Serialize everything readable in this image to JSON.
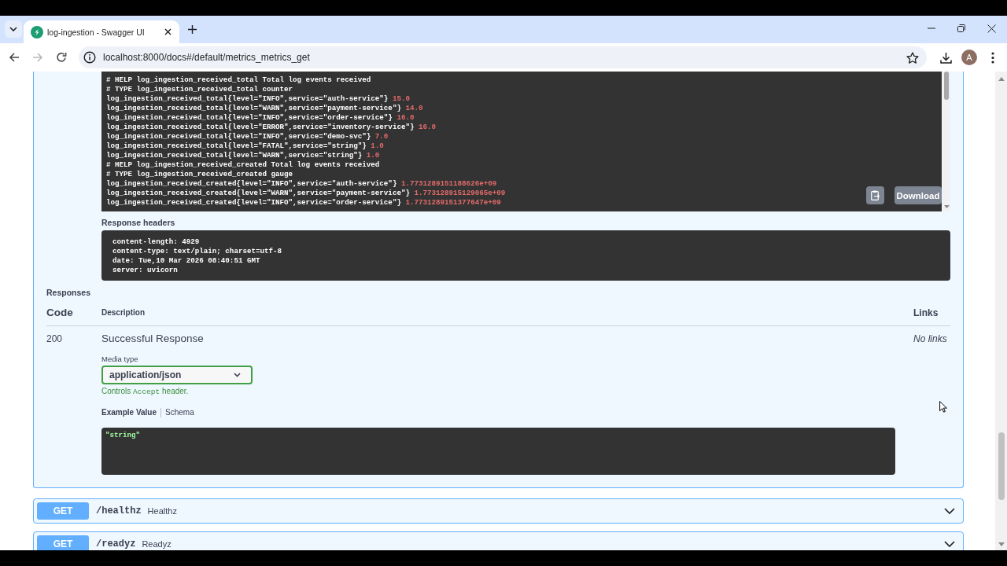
{
  "browser": {
    "tabs": [
      {
        "title": "log-ingestion - Swagger UI",
        "selected": true
      }
    ],
    "nav_buttons": [
      {
        "kind": "back",
        "disabled": false
      },
      {
        "kind": "forward",
        "disabled": true
      },
      {
        "kind": "reload",
        "disabled": false
      }
    ],
    "address_bar": {
      "url": "localhost:8000/docs#/default/metrics_metrics_get"
    },
    "profile": {
      "initial": "A"
    }
  },
  "response_body": {
    "lines": [
      {
        "text": "# HELP log_ingestion_received_total Total log events received"
      },
      {
        "text": "# TYPE log_ingestion_received_total counter"
      },
      {
        "text": "log_ingestion_received_total{level=\"INFO\",service=\"auth-service\"}",
        "value": "15.0"
      },
      {
        "text": "log_ingestion_received_total{level=\"WARN\",service=\"payment-service\"}",
        "value": "14.0"
      },
      {
        "text": "log_ingestion_received_total{level=\"INFO\",service=\"order-service\"}",
        "value": "16.0"
      },
      {
        "text": "log_ingestion_received_total{level=\"ERROR\",service=\"inventory-service\"}",
        "value": "16.0"
      },
      {
        "text": "log_ingestion_received_total{level=\"INFO\",service=\"demo-svc\"}",
        "value": "7.0"
      },
      {
        "text": "log_ingestion_received_total{level=\"FATAL\",service=\"string\"}",
        "value": "1.0"
      },
      {
        "text": "log_ingestion_received_total{level=\"WARN\",service=\"string\"}",
        "value": "1.0"
      },
      {
        "text": "# HELP log_ingestion_received_created Total log events received"
      },
      {
        "text": "# TYPE log_ingestion_received_created gauge"
      },
      {
        "text": "log_ingestion_received_created{level=\"INFO\",service=\"auth-service\"}",
        "value": "1.7731289151188626e+09"
      },
      {
        "text": "log_ingestion_received_created{level=\"WARN\",service=\"payment-service\"}",
        "value": "1.773128915129065e+09"
      },
      {
        "text": "log_ingestion_received_created{level=\"INFO\",service=\"order-service\"}",
        "value": "1.7731289151377647e+09"
      }
    ],
    "download_button": "Download"
  },
  "response_headers": {
    "label": "Response headers",
    "lines": [
      "content-length: 4929",
      "content-type: text/plain; charset=utf-8",
      "date: Tue,10 Mar 2026 08:40:51 GMT",
      "server: uvicorn"
    ]
  },
  "responses": {
    "title": "Responses",
    "columns": [
      "Code",
      "Description",
      "Links"
    ],
    "rows": [
      {
        "code": "200",
        "description": "Successful Response",
        "links": "No links",
        "media_type": {
          "label": "Media type",
          "value": "application/json",
          "hint": {
            "before": "Controls",
            "code": "Accept",
            "after": "header."
          }
        },
        "example_tabs": [
          {
            "label": "Example Value",
            "selected": true
          },
          {
            "label": "Schema",
            "selected": false
          }
        ],
        "example": "\"string\""
      }
    ]
  },
  "endpoints": [
    {
      "method": "GET",
      "path": "/healthz",
      "summary": "Healthz",
      "expanded": false
    },
    {
      "method": "GET",
      "path": "/readyz",
      "summary": "Readyz",
      "expanded": false
    }
  ]
}
